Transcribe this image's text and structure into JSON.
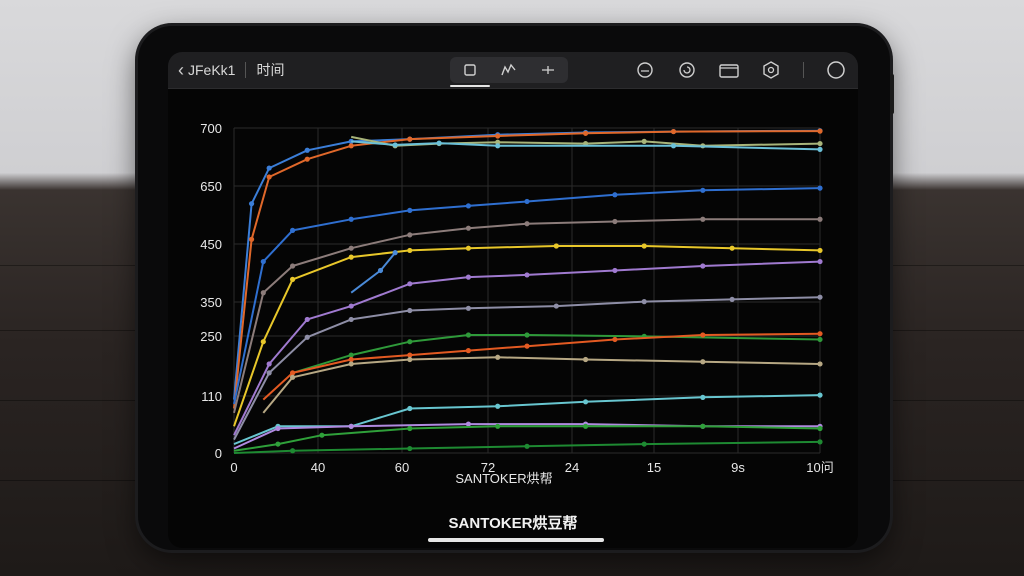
{
  "topbar": {
    "back_label": "JFeKk1",
    "title": "时间"
  },
  "toolbar_icons": [
    "device-icon",
    "curve-icon",
    "crosshair-icon",
    "timer-icon",
    "refresh-icon",
    "folder-icon",
    "settings-icon",
    "profile-icon"
  ],
  "chart_data": {
    "type": "line",
    "x_tick_labels": [
      "0",
      "40",
      "60",
      "72",
      "24",
      "15",
      "9s",
      "10问"
    ],
    "y_tick_labels": [
      "700",
      "650",
      "450",
      "350",
      "250",
      "110",
      "0"
    ],
    "x_axis_caption": "SANTOKER烘帮",
    "series": [
      {
        "color": "#3b7ed8",
        "values": [
          [
            0,
            120
          ],
          [
            6,
            560
          ],
          [
            12,
            640
          ],
          [
            25,
            680
          ],
          [
            40,
            700
          ],
          [
            60,
            705
          ],
          [
            90,
            715
          ],
          [
            120,
            720
          ],
          [
            150,
            722
          ],
          [
            200,
            724
          ]
        ]
      },
      {
        "color": "#e0682a",
        "values": [
          [
            0,
            100
          ],
          [
            6,
            480
          ],
          [
            12,
            620
          ],
          [
            25,
            660
          ],
          [
            40,
            690
          ],
          [
            60,
            705
          ],
          [
            90,
            712
          ],
          [
            120,
            718
          ],
          [
            150,
            722
          ],
          [
            200,
            723
          ]
        ]
      },
      {
        "color": "#a8b47a",
        "values": [
          [
            40,
            710
          ],
          [
            55,
            690
          ],
          [
            70,
            695
          ],
          [
            90,
            698
          ],
          [
            120,
            695
          ],
          [
            140,
            700
          ],
          [
            160,
            690
          ],
          [
            200,
            695
          ]
        ]
      },
      {
        "color": "#6bc0d8",
        "values": [
          [
            40,
            700
          ],
          [
            55,
            692
          ],
          [
            70,
            696
          ],
          [
            90,
            690
          ],
          [
            150,
            690
          ],
          [
            200,
            682
          ]
        ]
      },
      {
        "color": "#2f6fd0",
        "values": [
          [
            0,
            110
          ],
          [
            10,
            430
          ],
          [
            20,
            500
          ],
          [
            40,
            525
          ],
          [
            60,
            545
          ],
          [
            80,
            555
          ],
          [
            100,
            565
          ],
          [
            130,
            580
          ],
          [
            160,
            590
          ],
          [
            200,
            595
          ]
        ]
      },
      {
        "color": "#8c7c7a",
        "values": [
          [
            0,
            90
          ],
          [
            10,
            360
          ],
          [
            20,
            420
          ],
          [
            40,
            460
          ],
          [
            60,
            490
          ],
          [
            80,
            505
          ],
          [
            100,
            515
          ],
          [
            130,
            520
          ],
          [
            160,
            525
          ],
          [
            200,
            525
          ]
        ]
      },
      {
        "color": "#e8c72a",
        "values": [
          [
            0,
            60
          ],
          [
            10,
            250
          ],
          [
            20,
            390
          ],
          [
            40,
            440
          ],
          [
            60,
            455
          ],
          [
            80,
            460
          ],
          [
            110,
            465
          ],
          [
            140,
            465
          ],
          [
            170,
            460
          ],
          [
            200,
            455
          ]
        ]
      },
      {
        "color": "#4a8ad8",
        "values": [
          [
            40,
            360
          ],
          [
            50,
            410
          ],
          [
            55,
            450
          ]
        ]
      },
      {
        "color": "#a07ad0",
        "values": [
          [
            0,
            40
          ],
          [
            12,
            200
          ],
          [
            25,
            300
          ],
          [
            40,
            330
          ],
          [
            60,
            380
          ],
          [
            80,
            395
          ],
          [
            100,
            400
          ],
          [
            130,
            410
          ],
          [
            160,
            420
          ],
          [
            200,
            430
          ]
        ]
      },
      {
        "color": "#8e8ea6",
        "values": [
          [
            0,
            30
          ],
          [
            12,
            180
          ],
          [
            25,
            260
          ],
          [
            40,
            300
          ],
          [
            60,
            320
          ],
          [
            80,
            325
          ],
          [
            110,
            330
          ],
          [
            140,
            340
          ],
          [
            170,
            345
          ],
          [
            200,
            350
          ]
        ]
      },
      {
        "color": "#2f9a3a",
        "values": [
          [
            20,
            180
          ],
          [
            40,
            220
          ],
          [
            60,
            250
          ],
          [
            80,
            265
          ],
          [
            100,
            265
          ],
          [
            140,
            262
          ],
          [
            200,
            255
          ]
        ]
      },
      {
        "color": "#e35a22",
        "values": [
          [
            10,
            120
          ],
          [
            20,
            180
          ],
          [
            40,
            210
          ],
          [
            60,
            220
          ],
          [
            80,
            230
          ],
          [
            100,
            240
          ],
          [
            130,
            255
          ],
          [
            160,
            265
          ],
          [
            200,
            268
          ]
        ]
      },
      {
        "color": "#b7a884",
        "values": [
          [
            10,
            90
          ],
          [
            20,
            170
          ],
          [
            40,
            200
          ],
          [
            60,
            210
          ],
          [
            90,
            215
          ],
          [
            120,
            210
          ],
          [
            160,
            205
          ],
          [
            200,
            200
          ]
        ]
      },
      {
        "color": "#68c6d0",
        "values": [
          [
            0,
            20
          ],
          [
            15,
            60
          ],
          [
            40,
            60
          ],
          [
            60,
            100
          ],
          [
            90,
            105
          ],
          [
            120,
            115
          ],
          [
            160,
            125
          ],
          [
            200,
            130
          ]
        ]
      },
      {
        "color": "#b08ae0",
        "values": [
          [
            0,
            10
          ],
          [
            15,
            55
          ],
          [
            40,
            60
          ],
          [
            80,
            65
          ],
          [
            120,
            65
          ],
          [
            160,
            60
          ],
          [
            200,
            60
          ]
        ]
      },
      {
        "color": "#2fa03a",
        "values": [
          [
            0,
            5
          ],
          [
            15,
            20
          ],
          [
            30,
            40
          ],
          [
            60,
            55
          ],
          [
            90,
            60
          ],
          [
            120,
            60
          ],
          [
            160,
            60
          ],
          [
            200,
            55
          ]
        ]
      },
      {
        "color": "#1e8a32",
        "values": [
          [
            0,
            0
          ],
          [
            20,
            5
          ],
          [
            60,
            10
          ],
          [
            100,
            15
          ],
          [
            140,
            20
          ],
          [
            200,
            25
          ]
        ]
      }
    ]
  },
  "footer": {
    "brand": "SANTOKER烘豆帮"
  }
}
